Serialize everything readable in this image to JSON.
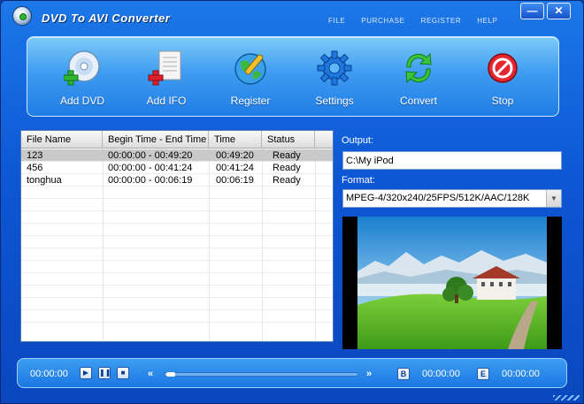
{
  "window": {
    "title": "DVD To AVI Converter",
    "menu": [
      "FILE",
      "PURCHASE",
      "REGISTER",
      "HELP"
    ],
    "minimize_glyph": "—",
    "close_glyph": "✕"
  },
  "toolbar": [
    {
      "label": "Add DVD",
      "icon": "add-dvd-icon"
    },
    {
      "label": "Add IFO",
      "icon": "add-ifo-icon"
    },
    {
      "label": "Register",
      "icon": "register-icon"
    },
    {
      "label": "Settings",
      "icon": "gear-icon"
    },
    {
      "label": "Convert",
      "icon": "convert-icon"
    },
    {
      "label": "Stop",
      "icon": "stop-icon"
    }
  ],
  "list": {
    "columns": [
      "File Name",
      "Begin Time - End Time",
      "Time",
      "Status"
    ],
    "rows": [
      {
        "name": "123",
        "range": "00:00:00 - 00:49:20",
        "time": "00:49:20",
        "status": "Ready",
        "selected": true
      },
      {
        "name": "456",
        "range": "00:00:00 - 00:41:24",
        "time": "00:41:24",
        "status": "Ready",
        "selected": false
      },
      {
        "name": "tonghua",
        "range": "00:00:00 - 00:06:19",
        "time": "00:06:19",
        "status": "Ready",
        "selected": false
      }
    ]
  },
  "output": {
    "label": "Output:",
    "value": "C:\\My iPod"
  },
  "format": {
    "label": "Format:",
    "value": "MPEG-4/320x240/25FPS/512K/AAC/128K"
  },
  "player": {
    "current_time": "00:00:00",
    "begin_label": "B",
    "begin_time": "00:00:00",
    "end_label": "E",
    "end_time": "00:00:00",
    "seek_position": 0.0
  },
  "colors": {
    "accent": "#0d56d4",
    "toolbar": "#3f9cf0",
    "selection": "#c9c9c9"
  }
}
